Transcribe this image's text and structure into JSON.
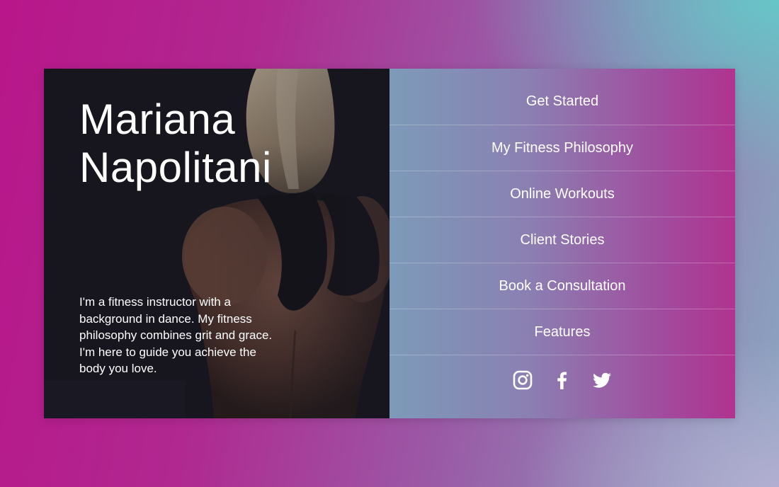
{
  "hero": {
    "name_first": "Mariana",
    "name_last": "Napolitani",
    "bio": "I'm a fitness instructor with a background in dance. My fitness philosophy combines grit and grace. I'm here to guide you achieve the body you love."
  },
  "menu": {
    "items": [
      {
        "label": "Get Started"
      },
      {
        "label": "My Fitness Philosophy"
      },
      {
        "label": "Online Workouts"
      },
      {
        "label": "Client Stories"
      },
      {
        "label": "Book a Consultation"
      },
      {
        "label": "Features"
      }
    ]
  },
  "social": {
    "icons": [
      "instagram-icon",
      "facebook-icon",
      "twitter-icon"
    ]
  },
  "colors": {
    "hero_bg": "#17161f",
    "text": "#ffffff",
    "page_magenta": "#b8168a",
    "page_teal": "#64c8c8"
  }
}
